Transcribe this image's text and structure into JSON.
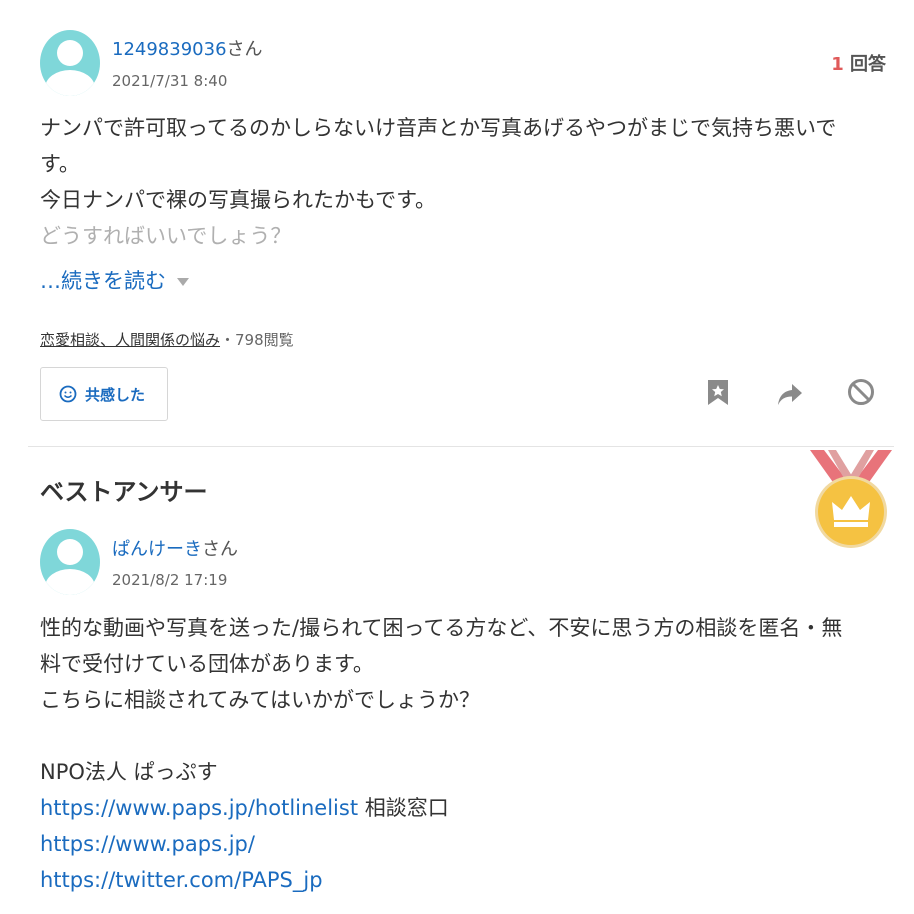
{
  "question": {
    "user_name": "1249839036",
    "user_suffix": "さん",
    "date": "2021/7/31 8:40",
    "answer_count": "1",
    "answer_count_label": "回答",
    "lines": [
      "ナンパで許可取ってるのかしらないけ音声とか写真あげるやつがまじで気持ち悪いで",
      "す。",
      "今日ナンパで裸の写真撮られたかもです。"
    ],
    "faded_line": "どうすればいいでしょう？",
    "read_more": "…続きを読む",
    "category": "恋愛相談、人間関係の悩み",
    "views": "・798閲覧",
    "empathy_button": "共感した"
  },
  "best_answer": {
    "heading": "ベストアンサー",
    "user_name": "ぱんけーき",
    "user_suffix": "さん",
    "date": "2021/8/2 17:19",
    "lines": [
      "性的な動画や写真を送った/撮られて困ってる方など、不安に思う方の相談を匿名・無",
      "料で受付けている団体があります。",
      "こちらに相談されてみてはいかがでしょうか？"
    ],
    "org_name": "NPO法人 ぱっぷす",
    "link1": "https://www.paps.jp/hotlinelist",
    "link1_suffix": " 相談窓口",
    "link2": "https://www.paps.jp/",
    "link3": "https://twitter.com/PAPS_jp"
  },
  "icons": {
    "avatar": "user-avatar-icon",
    "empathy": "smile-icon",
    "bookmark": "bookmark-star-icon",
    "share": "share-arrow-icon",
    "block": "block-icon",
    "medal": "gold-medal-crown-icon",
    "dropdown": "triangle-down-icon"
  },
  "colors": {
    "link": "#1a6bbf",
    "answer_count": "#e05a5a",
    "avatar": "#7fd7d9",
    "medal": "#f5c242",
    "ribbon": "#e8737a"
  }
}
